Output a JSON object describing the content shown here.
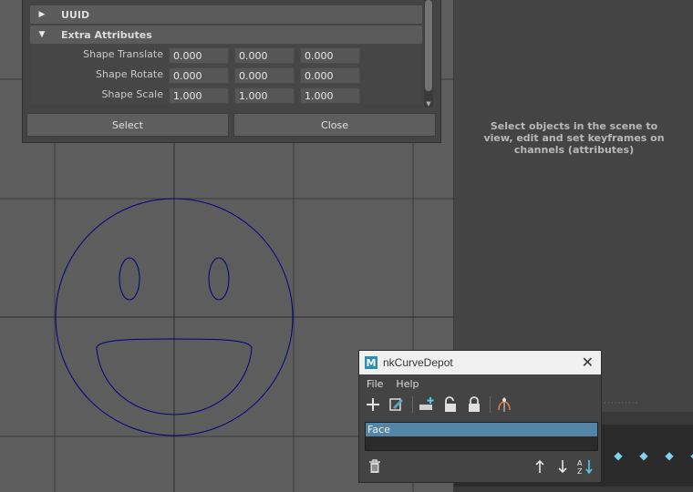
{
  "attribute_editor": {
    "sections": {
      "uuid": "UUID",
      "extra_attributes": "Extra Attributes"
    },
    "rows": [
      {
        "label": "Shape Translate",
        "values": [
          "0.000",
          "0.000",
          "0.000"
        ]
      },
      {
        "label": "Shape Rotate",
        "values": [
          "0.000",
          "0.000",
          "0.000"
        ]
      },
      {
        "label": "Shape Scale",
        "values": [
          "1.000",
          "1.000",
          "1.000"
        ]
      }
    ],
    "select_label": "Select",
    "close_label": "Close"
  },
  "channel_box": {
    "message": "Select objects in the scene to view, edit and set keyframes on channels (attributes)"
  },
  "depot": {
    "title": "nkCurveDepot",
    "logo": "M",
    "menu": [
      "File",
      "Help"
    ],
    "toolbar_icons": [
      "add-icon",
      "edit-icon",
      "add-shape-icon",
      "unlock-icon",
      "lock-icon",
      "mirror-icon"
    ],
    "items": [
      "Face"
    ],
    "selected_item": "Face",
    "bottom_icons": [
      "trash-icon",
      "arrow-up-icon",
      "arrow-down-icon",
      "sort-az-icon"
    ]
  },
  "colors": {
    "viewport_bg": "#5d5d5d",
    "curve": "#000080",
    "selection": "#5285a6",
    "accent": "#2b8fb2"
  }
}
